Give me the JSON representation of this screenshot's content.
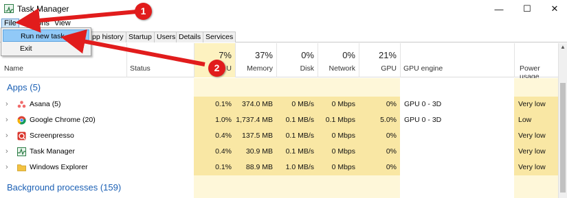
{
  "window": {
    "title": "Task Manager",
    "minimize": "—",
    "maximize": "☐",
    "close": "✕"
  },
  "menu": {
    "file": "File",
    "options": "Options",
    "view": "View"
  },
  "file_menu": {
    "items": [
      "Run new task",
      "Exit"
    ]
  },
  "tabs": [
    "pp history",
    "Startup",
    "Users",
    "Details",
    "Services"
  ],
  "header": {
    "name": "Name",
    "status": "Status",
    "cpu": {
      "pct": "7%",
      "label": "U"
    },
    "memory": {
      "pct": "37%",
      "label": "Memory"
    },
    "disk": {
      "pct": "0%",
      "label": "Disk"
    },
    "network": {
      "pct": "0%",
      "label": "Network"
    },
    "gpu": {
      "pct": "21%",
      "label": "GPU"
    },
    "gpu_engine": "GPU engine",
    "power_usage": "Power usage"
  },
  "groups": {
    "apps": "Apps (5)",
    "background": "Background processes (159)"
  },
  "rows": [
    {
      "name": "Asana (5)",
      "icon": "asana-icon",
      "cpu": "0.1%",
      "memory": "374.0 MB",
      "disk": "0 MB/s",
      "network": "0 Mbps",
      "gpu": "0%",
      "gpu_engine": "GPU 0 - 3D",
      "power": "Very low"
    },
    {
      "name": "Google Chrome (20)",
      "icon": "chrome-icon",
      "cpu": "1.0%",
      "memory": "1,737.4 MB",
      "disk": "0.1 MB/s",
      "network": "0.1 Mbps",
      "gpu": "5.0%",
      "gpu_engine": "GPU 0 - 3D",
      "power": "Low"
    },
    {
      "name": "Screenpresso",
      "icon": "screenpresso-icon",
      "cpu": "0.4%",
      "memory": "137.5 MB",
      "disk": "0.1 MB/s",
      "network": "0 Mbps",
      "gpu": "0%",
      "gpu_engine": "",
      "power": "Very low"
    },
    {
      "name": "Task Manager",
      "icon": "task-manager-icon",
      "cpu": "0.4%",
      "memory": "30.9 MB",
      "disk": "0.1 MB/s",
      "network": "0 Mbps",
      "gpu": "0%",
      "gpu_engine": "",
      "power": "Very low"
    },
    {
      "name": "Windows Explorer",
      "icon": "folder-icon",
      "cpu": "0.1%",
      "memory": "88.9 MB",
      "disk": "1.0 MB/s",
      "network": "0 Mbps",
      "gpu": "0%",
      "gpu_engine": "",
      "power": "Very low"
    }
  ],
  "annotations": {
    "badge1": "1",
    "badge2": "2",
    "color": "#e11c1c"
  },
  "colors": {
    "group_text": "#1a5fb4",
    "cell_tint": "#fdf2c0",
    "menu_highlight": "#91c9f7"
  }
}
